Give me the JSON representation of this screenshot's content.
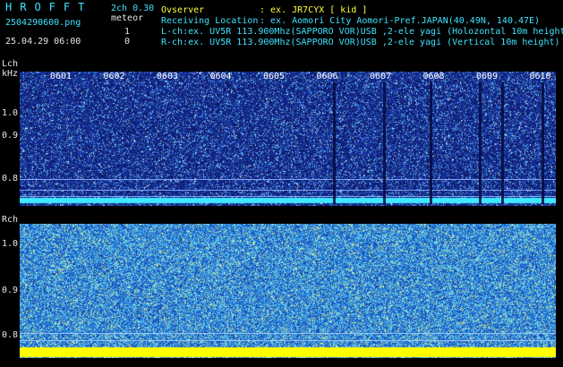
{
  "header": {
    "logo": "HROFFT",
    "mode": "2ch 0.30",
    "type_label": "meteor",
    "filename": "2504290600.png",
    "datetime": "25.04.29 06:00",
    "count_l": "1",
    "count_r": "0",
    "observer_label": "Ovserver",
    "observer_value": ": ex. JR7CYX [ kid ]",
    "location_label": "Receiving Location",
    "location_value": ": ex. Aomori City Aomori-Pref.JAPAN(40.49N, 140.47E)",
    "lch_info": "L-ch:ex. UV5R 113.900Mhz(SAPPORO VOR)USB ,2-ele yagi (Holozontal 10m height)",
    "rch_info": "R-ch:ex. UV5R 113.900Mhz(SAPPORO VOR)USB ,2-ele yagi (Vertical 10m height)"
  },
  "lch": {
    "label": "Lch",
    "unit": "kHz",
    "ticks": [
      "1.0",
      "0.9",
      "0.8"
    ],
    "minutes": [
      "0601",
      "0602",
      "0603",
      "0604",
      "0605",
      "0606",
      "0607",
      "0608",
      "0609",
      "0610"
    ]
  },
  "rch": {
    "label": "Rch",
    "ticks": [
      "1.0",
      "0.9",
      "0.8"
    ]
  },
  "colors": {
    "text_cyan": "#3fe3ff",
    "lch_background": "#101a6e",
    "rch_background": "#1c5fc0",
    "lch_carrier": "#40e8ff",
    "rch_carrier": "#ffff00"
  }
}
